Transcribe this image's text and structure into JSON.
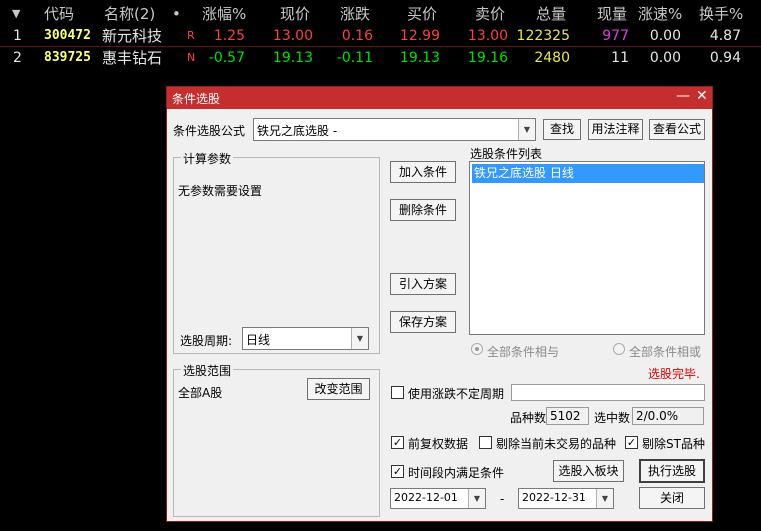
{
  "quotes": {
    "headers": {
      "code": "代码",
      "name": "名称(2)",
      "dot": "•",
      "change_pct": "涨幅%",
      "price": "现价",
      "change": "涨跌",
      "bid": "买价",
      "ask": "卖价",
      "volume": "总量",
      "last_vol": "现量",
      "speed": "涨速%",
      "turnover": "换手%"
    },
    "rows": [
      {
        "idx": "1",
        "code": "300472",
        "name": "新元科技",
        "flag": "R",
        "change_pct": "1.25",
        "price": "13.00",
        "change": "0.16",
        "bid": "12.99",
        "ask": "13.00",
        "volume": "122325",
        "last_vol": "977",
        "speed": "0.00",
        "turnover": "4.87"
      },
      {
        "idx": "2",
        "code": "839725",
        "name": "惠丰钻石",
        "flag": "N",
        "change_pct": "-0.57",
        "price": "19.13",
        "change": "-0.11",
        "bid": "19.13",
        "ask": "19.16",
        "volume": "2480",
        "last_vol": "11",
        "speed": "0.00",
        "turnover": "0.94"
      }
    ]
  },
  "dialog": {
    "title": "条件选股",
    "minimize_glyph": "—",
    "close_glyph": "✕",
    "formula_label": "条件选股公式",
    "formula_value": "铁兄之底选股 -",
    "find_button": "查找",
    "usage_button": "用法注释",
    "view_formula_button": "查看公式",
    "params_group": "计算参数",
    "params_text": "无参数需要设置",
    "period_label": "选股周期:",
    "period_value": "日线",
    "add_condition_button": "加入条件",
    "delete_condition_button": "删除条件",
    "import_scheme_button": "引入方案",
    "save_scheme_button": "保存方案",
    "condition_list_label": "选股条件列表",
    "condition_items": [
      "铁兄之底选股  日线"
    ],
    "radio_and": "全部条件相与",
    "radio_or": "全部条件相或",
    "status_text": "选股完毕.",
    "range_group": "选股范围",
    "range_value": "全部A股",
    "change_range_button": "改变范围",
    "use_unfixed_period": "使用涨跌不定周期",
    "count_label": "品种数",
    "count_value": "5102",
    "selected_label": "选中数",
    "selected_value": "2/0.0%",
    "adjusted_data": "前复权数据",
    "exclude_untraded": "剔除当前未交易的品种",
    "exclude_st": "剔除ST品种",
    "period_satisfy": "时间段内满足条件",
    "to_block_button": "选股入板块",
    "execute_button": "执行选股",
    "date_from": "2022-12-01",
    "date_sep": "-",
    "date_to": "2022-12-31",
    "close_button": "关闭",
    "colors": {
      "titlebar": "#c42e2e",
      "selection": "#3399ff",
      "status": "#e00000"
    }
  }
}
